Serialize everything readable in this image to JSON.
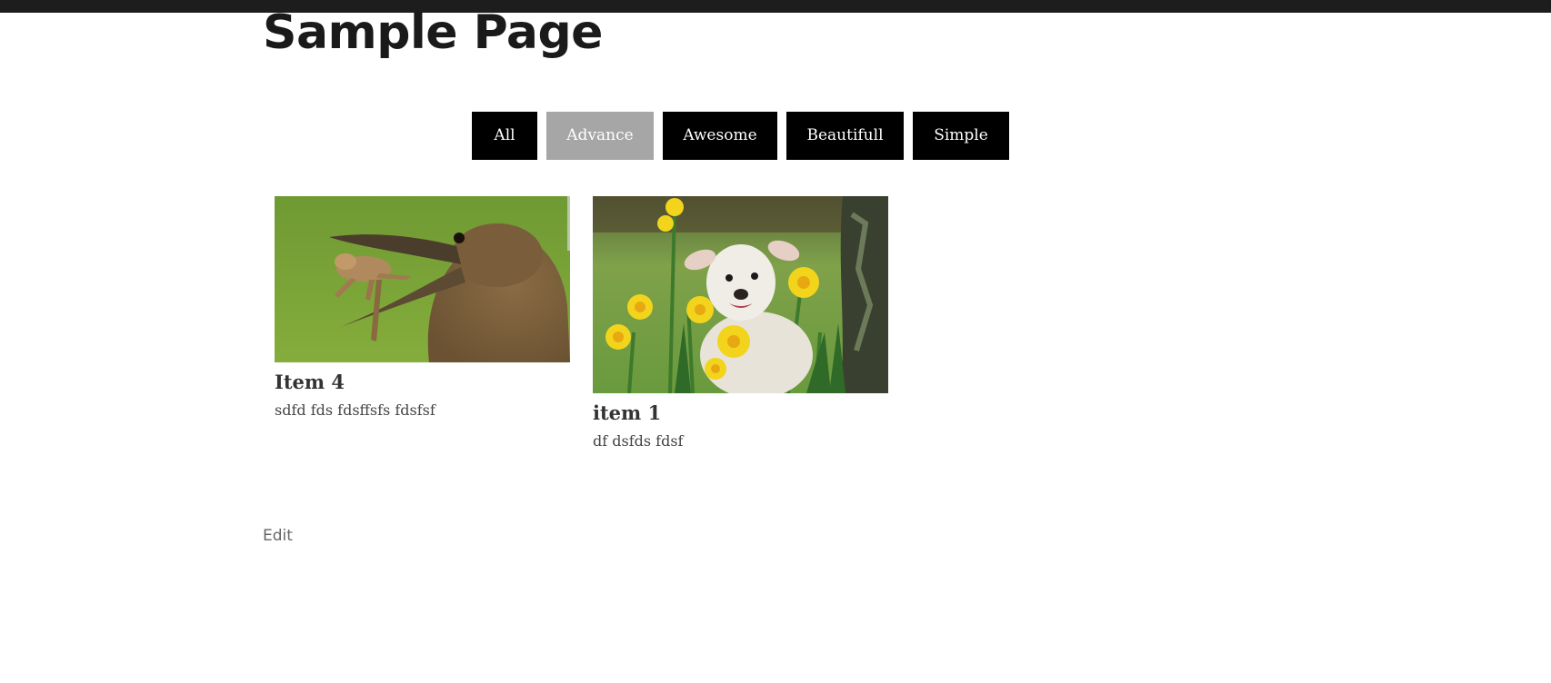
{
  "page": {
    "title": "Sample Page",
    "edit_label": "Edit"
  },
  "filters": [
    {
      "label": "All",
      "active": false
    },
    {
      "label": "Advance",
      "active": true
    },
    {
      "label": "Awesome",
      "active": false
    },
    {
      "label": "Beautifull",
      "active": false
    },
    {
      "label": "Simple",
      "active": false
    }
  ],
  "items": [
    {
      "title": "Item 4",
      "description": "sdfd fds fdsffsfs fdsfsf",
      "image": "hamerkop-bird-eating-frog"
    },
    {
      "title": "item 1",
      "description": "df dsfds fdsf",
      "image": "lamb-among-daffodils"
    }
  ],
  "colors": {
    "filter_bg": "#000000",
    "filter_active_bg": "#a6a6a6",
    "admin_bar": "#1d1d1d"
  }
}
